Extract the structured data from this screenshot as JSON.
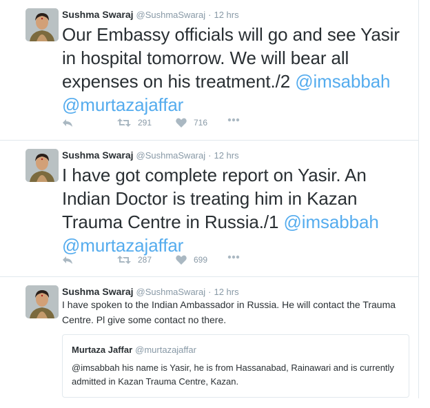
{
  "tweets": [
    {
      "name": "Sushma Swaraj",
      "handle": "@SushmaSwaraj",
      "sep": "·",
      "time": "12 hrs",
      "text": "Our Embassy officials will go and see Yasir in hospital tomorrow. We will bear all expenses on his treatment./2 ",
      "mention1": "@imsabbah",
      "mention2": "@murtazajaffar",
      "retweets": "291",
      "likes": "716"
    },
    {
      "name": "Sushma Swaraj",
      "handle": "@SushmaSwaraj",
      "sep": "·",
      "time": "12 hrs",
      "text": "I have got complete report on Yasir. An Indian Doctor is treating him in Kazan Trauma Centre in Russia./1 ",
      "mention1": "@imsabbah",
      "mention2": "@murtazajaffar",
      "retweets": "287",
      "likes": "699"
    },
    {
      "name": "Sushma Swaraj",
      "handle": "@SushmaSwaraj",
      "sep": "·",
      "time": "12 hrs",
      "text": "I have spoken to the Indian Ambassador in Russia. He will contact the Trauma Centre. Pl give some contact no there.",
      "quote": {
        "name": "Murtaza Jaffar",
        "handle": "@murtazajaffar",
        "text": "@imsabbah his name is Yasir, he is from Hassanabad, Rainawari and is currently admitted in Kazan Trauma Centre, Kazan."
      }
    }
  ],
  "icons": {
    "reply": "reply-icon",
    "retweet": "retweet-icon",
    "like": "heart-icon",
    "more": "more-dots-icon"
  },
  "colors": {
    "link": "#55acee",
    "muted": "#8899a6",
    "icon": "#aab8c2",
    "border": "#e1e8ed"
  }
}
